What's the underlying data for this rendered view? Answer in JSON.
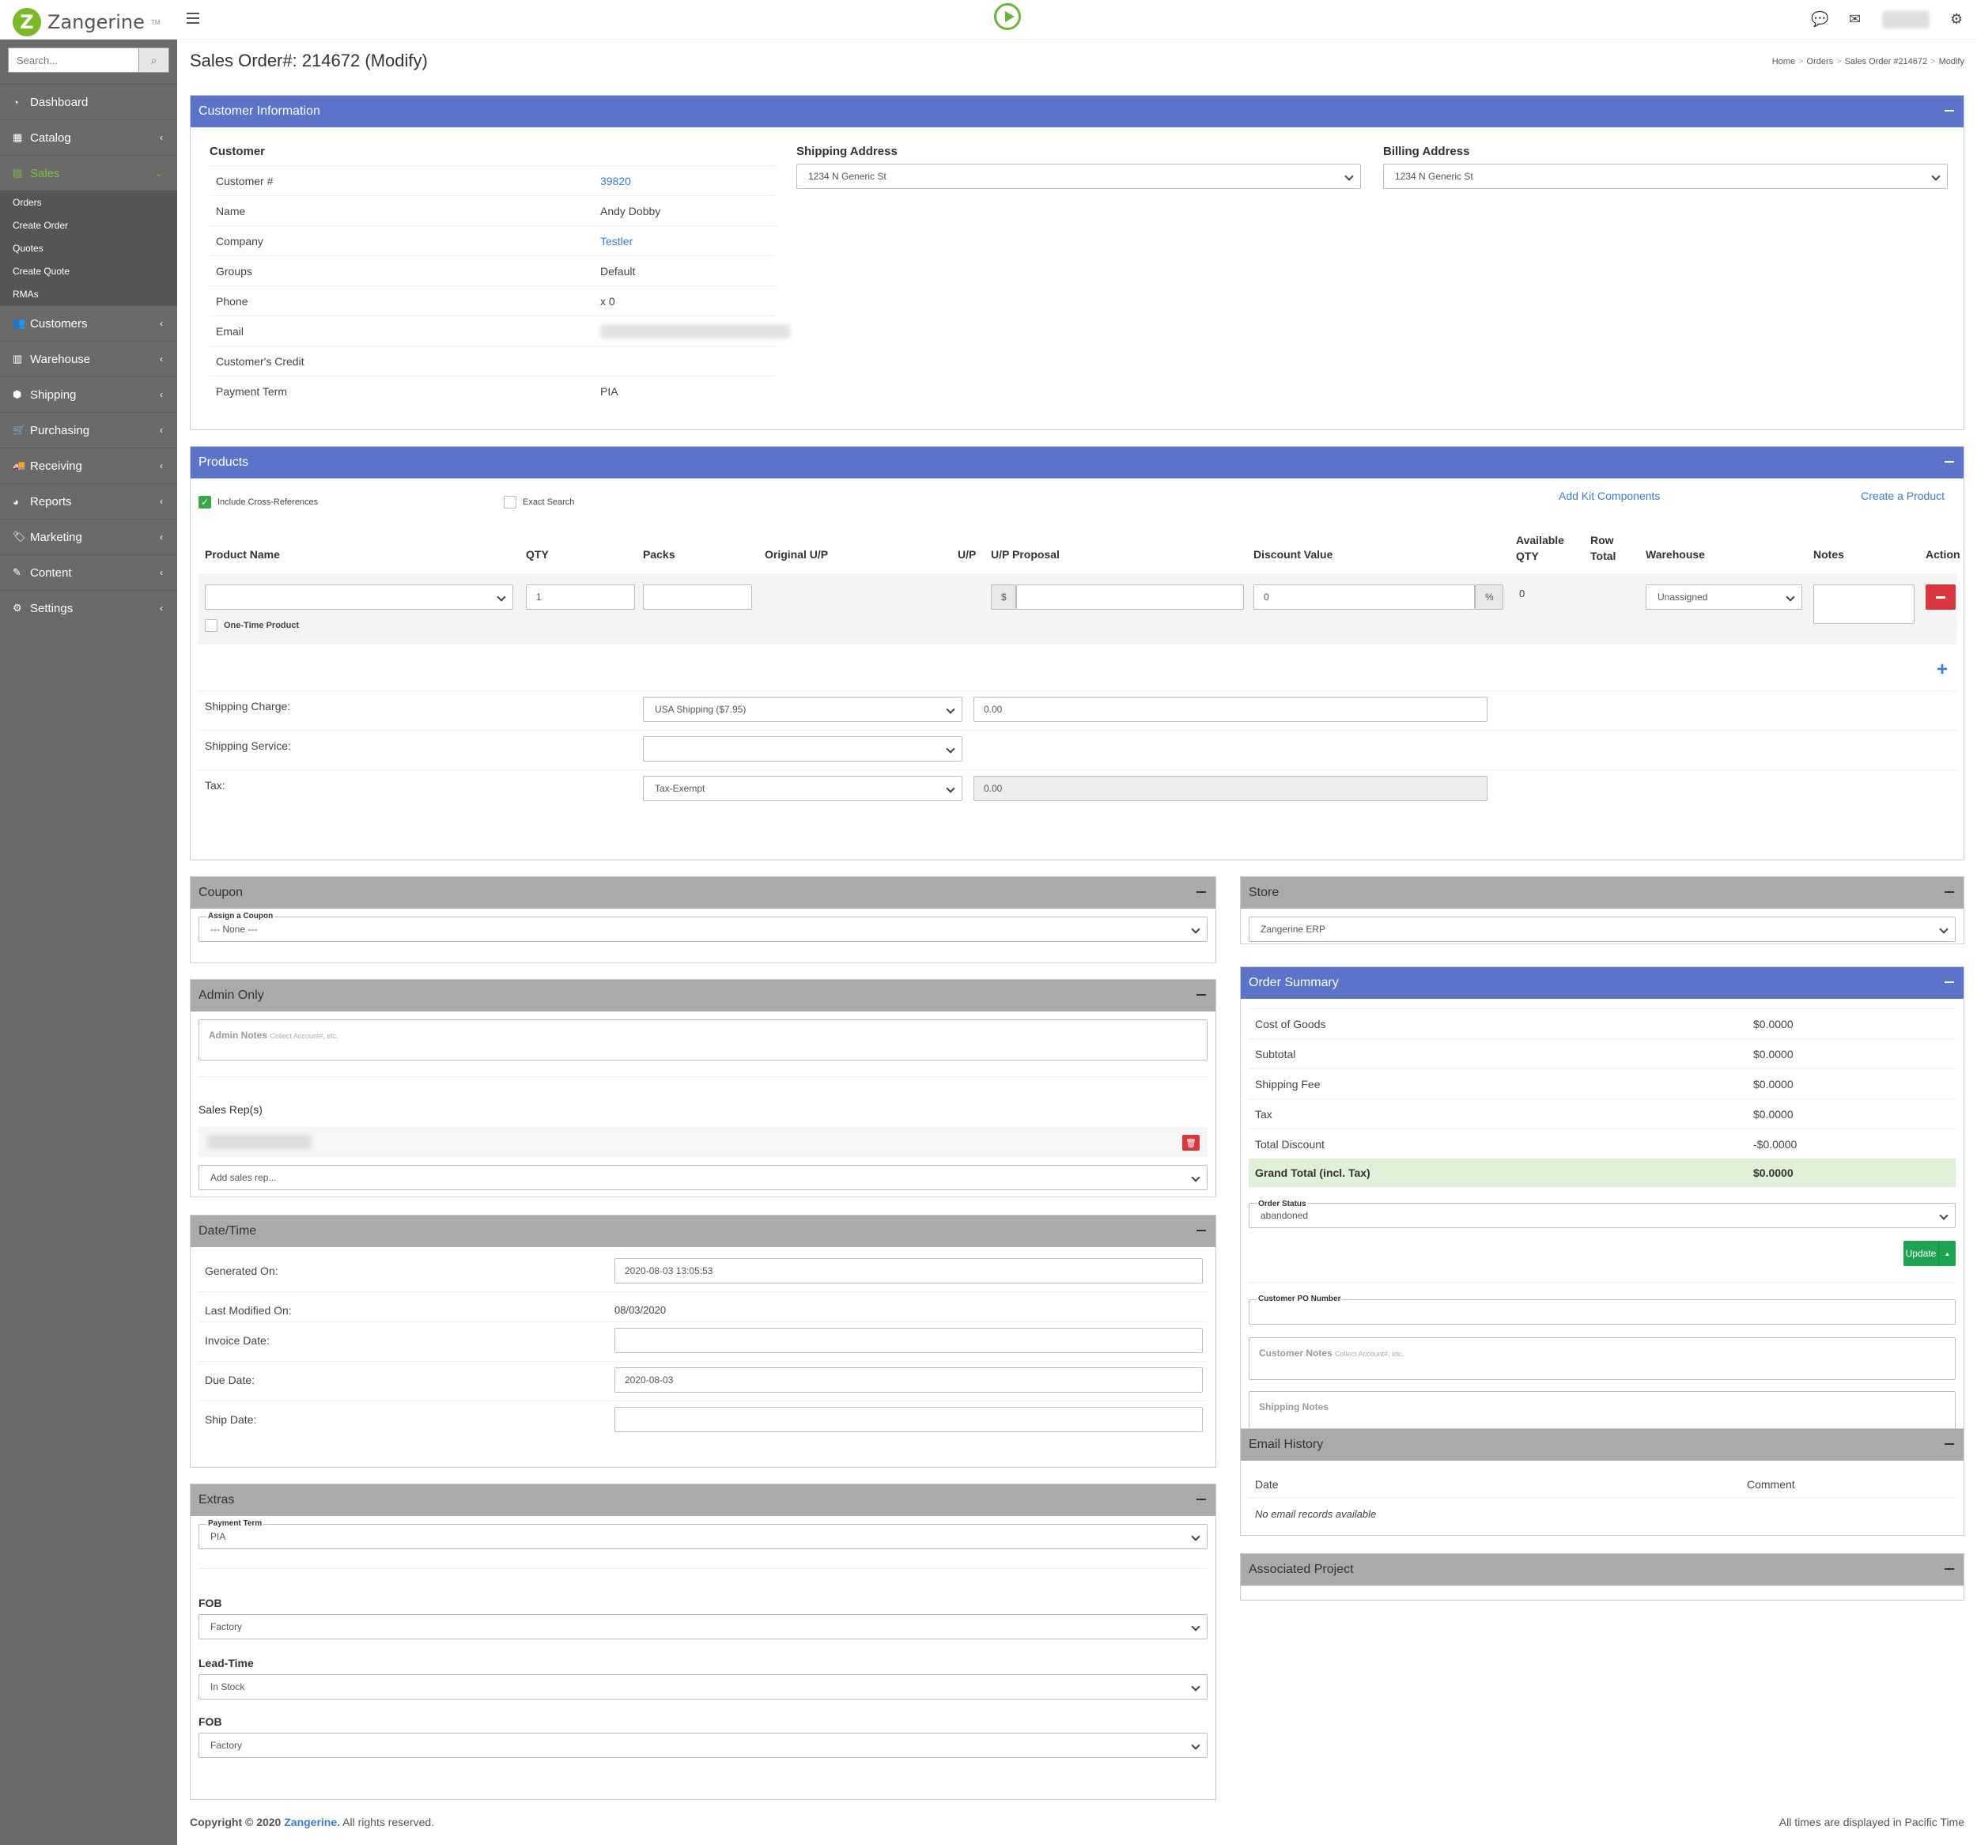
{
  "app": {
    "name": "Zangerine",
    "tm": "TM"
  },
  "search": {
    "placeholder": "Search..."
  },
  "nav": [
    {
      "label": "Dashboard",
      "icon": "dashboard-icon",
      "glyph": "◔"
    },
    {
      "label": "Catalog",
      "icon": "catalog-icon",
      "glyph": "▦"
    },
    {
      "label": "Sales",
      "icon": "sales-icon",
      "glyph": "▤"
    },
    {
      "label": "Customers",
      "icon": "customers-icon",
      "glyph": "👥"
    },
    {
      "label": "Warehouse",
      "icon": "warehouse-icon",
      "glyph": "▥"
    },
    {
      "label": "Shipping",
      "icon": "shipping-icon",
      "glyph": "⬢"
    },
    {
      "label": "Purchasing",
      "icon": "purchasing-icon",
      "glyph": "🛒"
    },
    {
      "label": "Receiving",
      "icon": "receiving-icon",
      "glyph": "🚚"
    },
    {
      "label": "Reports",
      "icon": "reports-icon",
      "glyph": "◕"
    },
    {
      "label": "Marketing",
      "icon": "marketing-icon",
      "glyph": "🏷"
    },
    {
      "label": "Content",
      "icon": "content-icon",
      "glyph": "✎"
    },
    {
      "label": "Settings",
      "icon": "settings-icon",
      "glyph": "⚙"
    }
  ],
  "subnav": [
    "Orders",
    "Create Order",
    "Quotes",
    "Create Quote",
    "RMAs"
  ],
  "page": {
    "title": "Sales Order#: 214672 (Modify)"
  },
  "breadcrumb": [
    "Home",
    ">",
    "Orders",
    ">",
    "Sales Order #214672",
    ">",
    "Modify"
  ],
  "customer_panel": {
    "title": "Customer Information",
    "customer_heading": "Customer",
    "rows": [
      {
        "label": "Customer #",
        "value": "39820",
        "link": true
      },
      {
        "label": "Name",
        "value": "Andy Dobby",
        "link": false
      },
      {
        "label": "Company",
        "value": "Testler",
        "link": true
      },
      {
        "label": "Groups",
        "value": "Default",
        "link": false
      },
      {
        "label": "Phone",
        "value": "x 0",
        "link": false
      },
      {
        "label": "Email",
        "value": "",
        "link": false
      },
      {
        "label": "Customer's Credit",
        "value": "",
        "link": false
      },
      {
        "label": "Payment Term",
        "value": "PIA",
        "link": false
      }
    ],
    "shipping_heading": "Shipping Address",
    "shipping_value": "1234 N Generic St",
    "billing_heading": "Billing Address",
    "billing_value": "1234 N Generic St"
  },
  "products": {
    "title": "Products",
    "include_xref": "Include Cross-References",
    "exact_search": "Exact Search",
    "add_kit": "Add Kit Components",
    "create_product": "Create a Product",
    "columns": [
      "Product Name",
      "QTY",
      "Packs",
      "Original U/P",
      "U/P",
      "U/P Proposal",
      "Discount Value",
      "Available QTY",
      "Row Total",
      "Warehouse",
      "Notes",
      "Action"
    ],
    "qty": "1",
    "currency": "$",
    "discount": "0",
    "percent": "%",
    "available": "0",
    "warehouse": "Unassigned",
    "one_time": "One-Time Product",
    "shipping_charge_label": "Shipping Charge:",
    "shipping_charge_select": "USA Shipping ($7.95)",
    "shipping_charge_value": "0.00",
    "shipping_service_label": "Shipping Service:",
    "tax_label": "Tax:",
    "tax_select": "Tax-Exempt",
    "tax_value": "0.00"
  },
  "coupon": {
    "title": "Coupon",
    "label": "Assign a Coupon",
    "value": "--- None ---"
  },
  "admin": {
    "title": "Admin Only",
    "notes_label": "Admin Notes",
    "notes_hint": "Collect Account#, etc.",
    "reps_label": "Sales Rep(s)",
    "add_rep": "Add sales rep..."
  },
  "datetime": {
    "title": "Date/Time",
    "rows": [
      {
        "label": "Generated On:",
        "value": "2020-08-03 13:05:53"
      },
      {
        "label": "Last Modified On:",
        "value": "08/03/2020"
      },
      {
        "label": "Invoice Date:",
        "value": ""
      },
      {
        "label": "Due Date:",
        "value": "2020-08-03"
      },
      {
        "label": "Ship Date:",
        "value": ""
      }
    ]
  },
  "extras": {
    "title": "Extras",
    "payment_term_label": "Payment Term",
    "payment_term": "PIA",
    "fob1_label": "FOB",
    "fob1": "Factory",
    "lead_label": "Lead-Time",
    "lead": "In Stock",
    "fob2_label": "FOB",
    "fob2": "Factory"
  },
  "store": {
    "title": "Store",
    "value": "Zangerine ERP"
  },
  "summary": {
    "title": "Order Summary",
    "rows": [
      {
        "label": "Cost of Goods",
        "value": "$0.0000"
      },
      {
        "label": "Subtotal",
        "value": "$0.0000"
      },
      {
        "label": "Shipping Fee",
        "value": "$0.0000"
      },
      {
        "label": "Tax",
        "value": "$0.0000"
      },
      {
        "label": "Total Discount",
        "value": "-$0.0000"
      }
    ],
    "grand_label": "Grand Total (incl. Tax)",
    "grand_value": "$0.0000",
    "status_label": "Order Status",
    "status": "abandoned",
    "update": "Update",
    "po_label": "Customer PO Number",
    "cust_notes_label": "Customer Notes",
    "cust_notes_hint": "Collect Account#, etc.",
    "ship_notes_label": "Shipping Notes"
  },
  "email_history": {
    "title": "Email History",
    "col_date": "Date",
    "col_comment": "Comment",
    "empty": "No email records available"
  },
  "project": {
    "title": "Associated Project"
  },
  "footer": {
    "copyright": "Copyright © 2020",
    "brand": "Zangerine.",
    "rights": "All rights reserved.",
    "tz": "All times are displayed in Pacific Time"
  },
  "colors": {
    "primary": "#5b74c9",
    "accent": "#7cc242",
    "sidebar": "#6a6a6a",
    "danger": "#d9363e",
    "success": "#1ea352"
  }
}
